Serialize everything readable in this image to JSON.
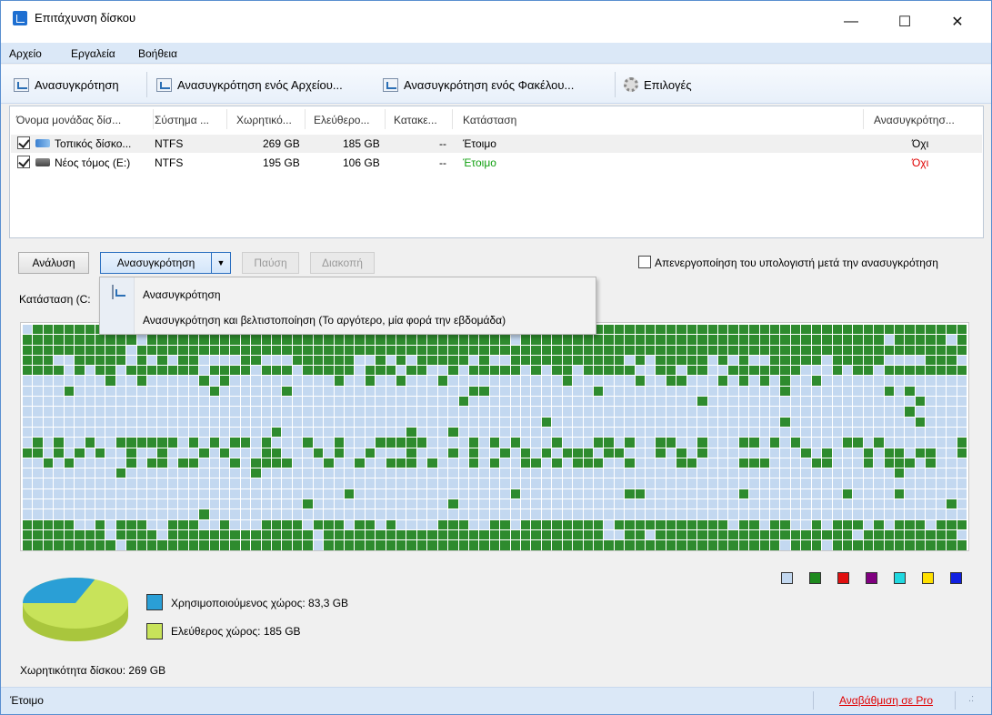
{
  "window": {
    "title": "Επιτάχυνση δίσκου",
    "minimize": "—",
    "maximize": "☐",
    "close": "✕"
  },
  "menu": [
    "Αρχείο",
    "Εργαλεία",
    "Βοήθεια"
  ],
  "toolbar": {
    "defrag": "Ανασυγκρότηση",
    "defrag_file": "Ανασυγκρότηση ενός Αρχείου...",
    "defrag_folder": "Ανασυγκρότηση ενός Φακέλου...",
    "options": "Επιλογές"
  },
  "table": {
    "headers": [
      "Όνομα μονάδας δίσ...",
      "Σύστημα ...",
      "Χωρητικό...",
      "Ελεύθερο...",
      "Κατακε...",
      "Κατάσταση",
      "Ανασυγκρότησ..."
    ],
    "rows": [
      {
        "name": "Τοπικός δίσκο...",
        "fs": "NTFS",
        "capacity": "269 GB",
        "free": "185 GB",
        "frag": "--",
        "status": "Έτοιμο",
        "defrag": "Όχι",
        "checked": true
      },
      {
        "name": "Νέος τόμος (E:)",
        "fs": "NTFS",
        "capacity": "195 GB",
        "free": "106 GB",
        "frag": "--",
        "status": "Έτοιμο",
        "defrag": "Όχι",
        "checked": true
      }
    ]
  },
  "actions": {
    "analyze": "Ανάλυση",
    "defrag": "Ανασυγκρότηση",
    "pause": "Παύση",
    "stop": "Διακοπή",
    "shutdown_label": "Απενεργοποίηση του υπολογιστή μετά την ανασυγκρότηση"
  },
  "tab": {
    "label": "Κατάσταση (C:"
  },
  "dropdown": {
    "item1": "Ανασυγκρότηση",
    "item2": "Ανασυγκρότηση και βελτιστοποίηση (Το αργότερο, μία φορά την εβδομάδα)"
  },
  "colors": {
    "used": "#2e8b2e",
    "free_block": "#c3d8f0",
    "pie_used": "#2a9fd6",
    "pie_free": "#c8e35a"
  },
  "legend_colors": [
    "#c3d8f0",
    "#1e8a1e",
    "#e01010",
    "#800080",
    "#20d8e0",
    "#ffe000",
    "#1020e0"
  ],
  "disk": {
    "used_label": "Χρησιμοποιούμενος χώρος: 83,3 GB",
    "free_label": "Ελεύθερος χώρος: 185 GB",
    "capacity_label": "Χωρητικότητα δίσκου: 269 GB",
    "used_fraction": 0.31
  },
  "status": {
    "left": "Έτοιμο",
    "upgrade": "Αναβάθμιση σε Pro"
  }
}
